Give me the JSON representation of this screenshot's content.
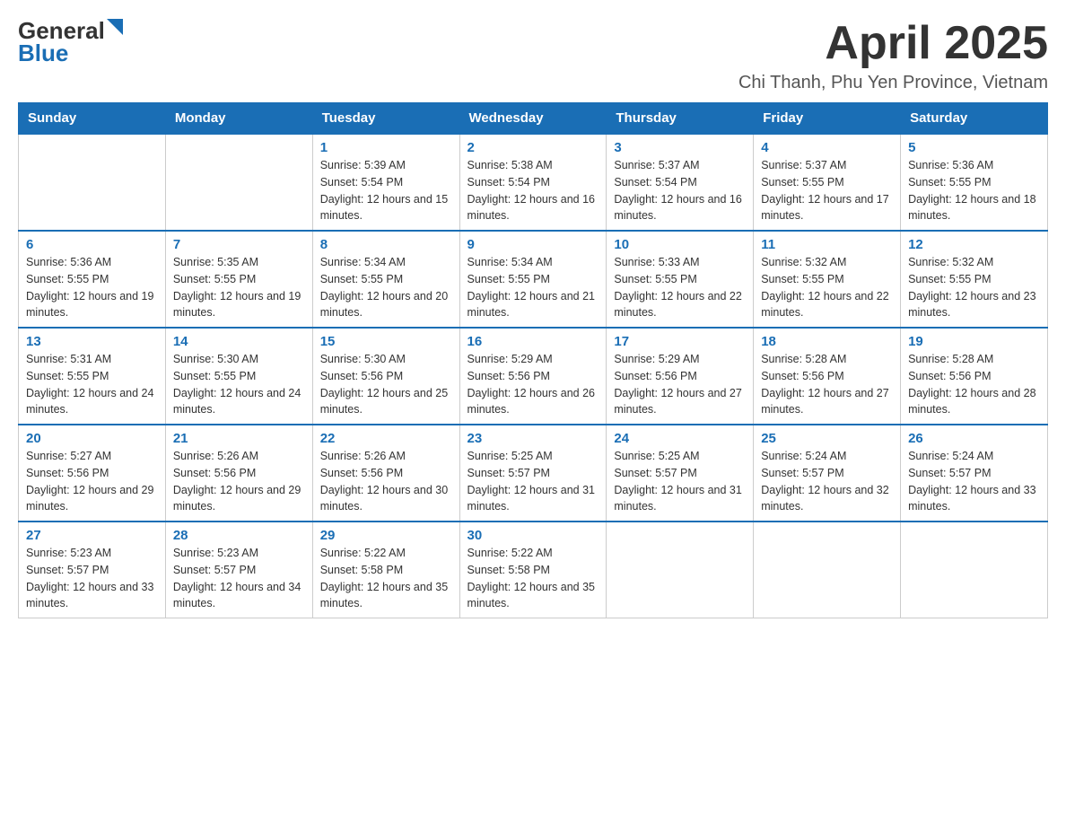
{
  "header": {
    "logo_text": "General",
    "logo_blue": "Blue",
    "title": "April 2025",
    "subtitle": "Chi Thanh, Phu Yen Province, Vietnam"
  },
  "days_of_week": [
    "Sunday",
    "Monday",
    "Tuesday",
    "Wednesday",
    "Thursday",
    "Friday",
    "Saturday"
  ],
  "weeks": [
    [
      {
        "day": "",
        "sunrise": "",
        "sunset": "",
        "daylight": ""
      },
      {
        "day": "",
        "sunrise": "",
        "sunset": "",
        "daylight": ""
      },
      {
        "day": "1",
        "sunrise": "Sunrise: 5:39 AM",
        "sunset": "Sunset: 5:54 PM",
        "daylight": "Daylight: 12 hours and 15 minutes."
      },
      {
        "day": "2",
        "sunrise": "Sunrise: 5:38 AM",
        "sunset": "Sunset: 5:54 PM",
        "daylight": "Daylight: 12 hours and 16 minutes."
      },
      {
        "day": "3",
        "sunrise": "Sunrise: 5:37 AM",
        "sunset": "Sunset: 5:54 PM",
        "daylight": "Daylight: 12 hours and 16 minutes."
      },
      {
        "day": "4",
        "sunrise": "Sunrise: 5:37 AM",
        "sunset": "Sunset: 5:55 PM",
        "daylight": "Daylight: 12 hours and 17 minutes."
      },
      {
        "day": "5",
        "sunrise": "Sunrise: 5:36 AM",
        "sunset": "Sunset: 5:55 PM",
        "daylight": "Daylight: 12 hours and 18 minutes."
      }
    ],
    [
      {
        "day": "6",
        "sunrise": "Sunrise: 5:36 AM",
        "sunset": "Sunset: 5:55 PM",
        "daylight": "Daylight: 12 hours and 19 minutes."
      },
      {
        "day": "7",
        "sunrise": "Sunrise: 5:35 AM",
        "sunset": "Sunset: 5:55 PM",
        "daylight": "Daylight: 12 hours and 19 minutes."
      },
      {
        "day": "8",
        "sunrise": "Sunrise: 5:34 AM",
        "sunset": "Sunset: 5:55 PM",
        "daylight": "Daylight: 12 hours and 20 minutes."
      },
      {
        "day": "9",
        "sunrise": "Sunrise: 5:34 AM",
        "sunset": "Sunset: 5:55 PM",
        "daylight": "Daylight: 12 hours and 21 minutes."
      },
      {
        "day": "10",
        "sunrise": "Sunrise: 5:33 AM",
        "sunset": "Sunset: 5:55 PM",
        "daylight": "Daylight: 12 hours and 22 minutes."
      },
      {
        "day": "11",
        "sunrise": "Sunrise: 5:32 AM",
        "sunset": "Sunset: 5:55 PM",
        "daylight": "Daylight: 12 hours and 22 minutes."
      },
      {
        "day": "12",
        "sunrise": "Sunrise: 5:32 AM",
        "sunset": "Sunset: 5:55 PM",
        "daylight": "Daylight: 12 hours and 23 minutes."
      }
    ],
    [
      {
        "day": "13",
        "sunrise": "Sunrise: 5:31 AM",
        "sunset": "Sunset: 5:55 PM",
        "daylight": "Daylight: 12 hours and 24 minutes."
      },
      {
        "day": "14",
        "sunrise": "Sunrise: 5:30 AM",
        "sunset": "Sunset: 5:55 PM",
        "daylight": "Daylight: 12 hours and 24 minutes."
      },
      {
        "day": "15",
        "sunrise": "Sunrise: 5:30 AM",
        "sunset": "Sunset: 5:56 PM",
        "daylight": "Daylight: 12 hours and 25 minutes."
      },
      {
        "day": "16",
        "sunrise": "Sunrise: 5:29 AM",
        "sunset": "Sunset: 5:56 PM",
        "daylight": "Daylight: 12 hours and 26 minutes."
      },
      {
        "day": "17",
        "sunrise": "Sunrise: 5:29 AM",
        "sunset": "Sunset: 5:56 PM",
        "daylight": "Daylight: 12 hours and 27 minutes."
      },
      {
        "day": "18",
        "sunrise": "Sunrise: 5:28 AM",
        "sunset": "Sunset: 5:56 PM",
        "daylight": "Daylight: 12 hours and 27 minutes."
      },
      {
        "day": "19",
        "sunrise": "Sunrise: 5:28 AM",
        "sunset": "Sunset: 5:56 PM",
        "daylight": "Daylight: 12 hours and 28 minutes."
      }
    ],
    [
      {
        "day": "20",
        "sunrise": "Sunrise: 5:27 AM",
        "sunset": "Sunset: 5:56 PM",
        "daylight": "Daylight: 12 hours and 29 minutes."
      },
      {
        "day": "21",
        "sunrise": "Sunrise: 5:26 AM",
        "sunset": "Sunset: 5:56 PM",
        "daylight": "Daylight: 12 hours and 29 minutes."
      },
      {
        "day": "22",
        "sunrise": "Sunrise: 5:26 AM",
        "sunset": "Sunset: 5:56 PM",
        "daylight": "Daylight: 12 hours and 30 minutes."
      },
      {
        "day": "23",
        "sunrise": "Sunrise: 5:25 AM",
        "sunset": "Sunset: 5:57 PM",
        "daylight": "Daylight: 12 hours and 31 minutes."
      },
      {
        "day": "24",
        "sunrise": "Sunrise: 5:25 AM",
        "sunset": "Sunset: 5:57 PM",
        "daylight": "Daylight: 12 hours and 31 minutes."
      },
      {
        "day": "25",
        "sunrise": "Sunrise: 5:24 AM",
        "sunset": "Sunset: 5:57 PM",
        "daylight": "Daylight: 12 hours and 32 minutes."
      },
      {
        "day": "26",
        "sunrise": "Sunrise: 5:24 AM",
        "sunset": "Sunset: 5:57 PM",
        "daylight": "Daylight: 12 hours and 33 minutes."
      }
    ],
    [
      {
        "day": "27",
        "sunrise": "Sunrise: 5:23 AM",
        "sunset": "Sunset: 5:57 PM",
        "daylight": "Daylight: 12 hours and 33 minutes."
      },
      {
        "day": "28",
        "sunrise": "Sunrise: 5:23 AM",
        "sunset": "Sunset: 5:57 PM",
        "daylight": "Daylight: 12 hours and 34 minutes."
      },
      {
        "day": "29",
        "sunrise": "Sunrise: 5:22 AM",
        "sunset": "Sunset: 5:58 PM",
        "daylight": "Daylight: 12 hours and 35 minutes."
      },
      {
        "day": "30",
        "sunrise": "Sunrise: 5:22 AM",
        "sunset": "Sunset: 5:58 PM",
        "daylight": "Daylight: 12 hours and 35 minutes."
      },
      {
        "day": "",
        "sunrise": "",
        "sunset": "",
        "daylight": ""
      },
      {
        "day": "",
        "sunrise": "",
        "sunset": "",
        "daylight": ""
      },
      {
        "day": "",
        "sunrise": "",
        "sunset": "",
        "daylight": ""
      }
    ]
  ]
}
